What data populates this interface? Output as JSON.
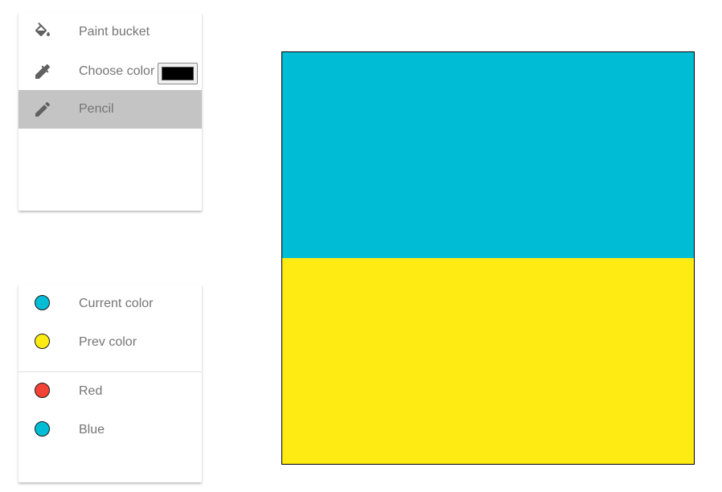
{
  "tools": {
    "items": [
      {
        "label": "Paint bucket",
        "icon": "paint-bucket-icon"
      },
      {
        "label": "Choose color",
        "icon": "eyedropper-icon"
      },
      {
        "label": "Pencil",
        "icon": "pencil-icon",
        "active": true
      }
    ],
    "color_input_value": "#000000"
  },
  "colors": {
    "current": {
      "label": "Current color",
      "color": "#00bcd4"
    },
    "prev": {
      "label": "Prev color",
      "color": "#ffeb14"
    },
    "presets": [
      {
        "label": "Red",
        "color": "#f44336"
      },
      {
        "label": "Blue",
        "color": "#00bcd4"
      }
    ]
  },
  "canvas": {
    "bands": [
      {
        "color": "#00bcd4"
      },
      {
        "color": "#ffeb14"
      }
    ]
  }
}
